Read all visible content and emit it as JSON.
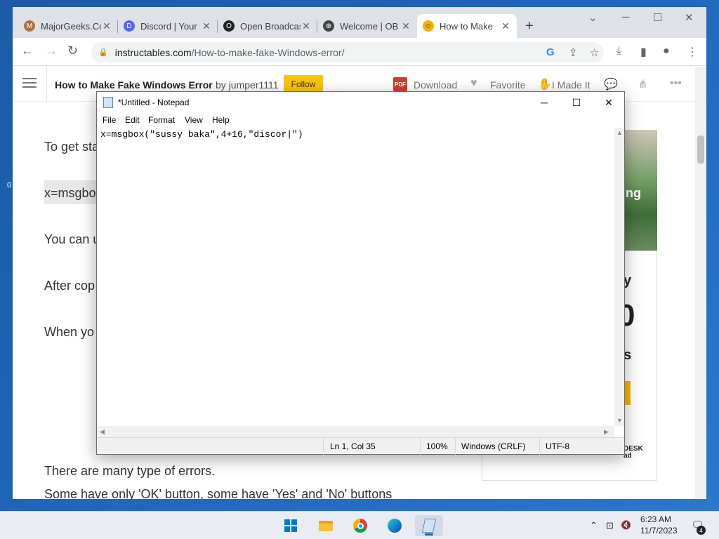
{
  "browser": {
    "tabs": [
      {
        "title": "MajorGeeks.Co",
        "close": "✕",
        "favicon_color": "#b07040",
        "favicon_glyph": "M",
        "icon": "majorgeeks-favicon-icon"
      },
      {
        "title": "Discord | Your",
        "close": "✕",
        "favicon_color": "#5865f2",
        "favicon_glyph": "D",
        "icon": "discord-favicon-icon"
      },
      {
        "title": "Open Broadcas",
        "close": "✕",
        "favicon_color": "#222222",
        "favicon_glyph": "O",
        "icon": "obs-favicon-icon"
      },
      {
        "title": "Welcome | OB",
        "close": "✕",
        "favicon_color": "#444444",
        "favicon_glyph": "⊕",
        "icon": "globe-favicon-icon"
      },
      {
        "title": "How to Make",
        "close": "✕",
        "favicon_color": "#f2b400",
        "favicon_glyph": "☺",
        "icon": "instructables-favicon-icon",
        "active": true
      }
    ],
    "new_tab": "+",
    "window_controls": {
      "minimize": "─",
      "maximize": "☐",
      "close": "✕",
      "tab_search": "⌄"
    },
    "nav": {
      "back": "←",
      "forward": "→",
      "reload": "↻"
    },
    "url": {
      "host": "instructables.com",
      "path": "/How-to-make-fake-Windows-error/"
    },
    "omnibox_icons": {
      "google": "G",
      "share": "⇪",
      "bookmark": "☆"
    },
    "toolbar_icons": {
      "download": "⤓",
      "sidepanel": "▮",
      "profile": "●",
      "menu": "⋮"
    }
  },
  "page": {
    "title": "How to Make Fake Windows Error",
    "by_prefix": "by",
    "author": "jumper1111",
    "follow": "Follow",
    "actions": {
      "download": "Download",
      "favorite": "Favorite",
      "made_it": "I Made It",
      "pdf_badge": "PDF"
    },
    "paragraphs": [
      "To get sta",
      "x=msgbo",
      "You can u",
      "After cop",
      "When yo",
      "There are many type of errors.",
      "Some have only 'OK' button, some have 'Yes' and 'No' buttons"
    ],
    "ad": {
      "img_text": "ing",
      "line1": "y",
      "line2": "0",
      "line3": "s",
      "brand": "DESK\nad"
    }
  },
  "notepad": {
    "title": "*Untitled - Notepad",
    "controls": {
      "minimize": "─",
      "maximize": "☐",
      "close": "✕"
    },
    "menu": [
      "File",
      "Edit",
      "Format",
      "View",
      "Help"
    ],
    "content": "x=msgbox(\"sussy baka\",4+16,\"discor|\")",
    "status": {
      "position": "Ln 1, Col 35",
      "zoom": "100%",
      "line_ending": "Windows (CRLF)",
      "encoding": "UTF-8"
    }
  },
  "taskbar": {
    "apps": [
      {
        "name": "start",
        "icon": "windows-start-icon"
      },
      {
        "name": "file-explorer",
        "icon": "folder-icon"
      },
      {
        "name": "chrome",
        "icon": "chrome-icon"
      },
      {
        "name": "edge",
        "icon": "edge-icon"
      },
      {
        "name": "notepad",
        "icon": "notepad-icon",
        "active": true
      }
    ],
    "tray": {
      "chevron": "⌃",
      "network": "⊡",
      "volume": "🔇"
    },
    "time": "6:23 AM",
    "date": "11/7/2023",
    "notifications": "4"
  },
  "desktop_icon_glyph": "0"
}
